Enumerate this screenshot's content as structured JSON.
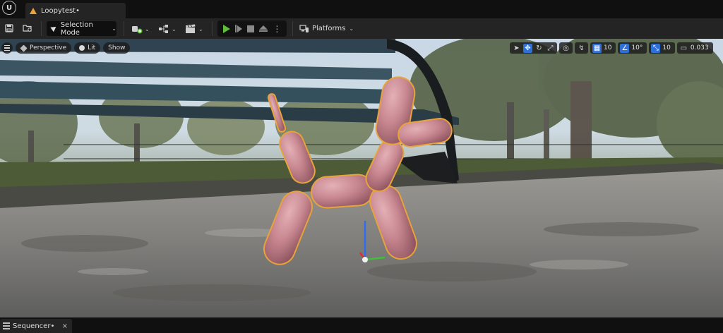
{
  "app": {
    "logo": "unreal-logo",
    "logo_text": "U"
  },
  "level_tab": {
    "label": "Loopytest•",
    "icon": "level-icon"
  },
  "toolbar": {
    "save_icon": "save-icon",
    "content_icon": "content-browser-icon",
    "selection_mode_label": "Selection Mode",
    "add_icon": "add-actor-icon",
    "blueprint_icon": "blueprint-icon",
    "cinematics_icon": "cinematics-icon",
    "play_icon": "play-icon",
    "step_icon": "step-icon",
    "stop_icon": "stop-icon",
    "eject_icon": "eject-icon",
    "platforms_label": "Platforms",
    "play_color": "#5fbf3a"
  },
  "viewport": {
    "menu_icon": "hamburger-icon",
    "perspective_label": "Perspective",
    "lit_label": "Lit",
    "show_label": "Show",
    "grid_snap_value": "10",
    "rotation_snap_value": "10°",
    "scale_snap_value": "10",
    "camera_speed_value": "0.033",
    "active_color": "#2f6fd8",
    "selection_outline_color": "#e8a33a",
    "balloon_color": "#c88790"
  },
  "sequencer_tab": {
    "label": "Sequencer•",
    "close": "×"
  }
}
